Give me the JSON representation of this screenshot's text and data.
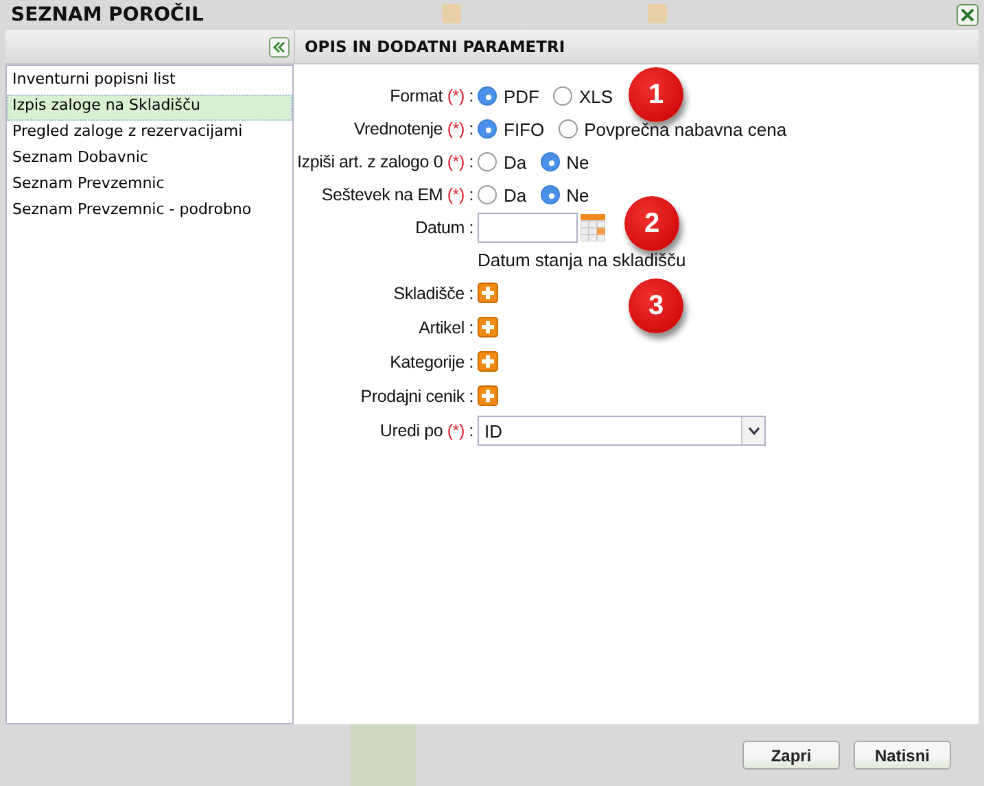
{
  "dialog": {
    "title": "SEZNAM POROČIL"
  },
  "report_list": {
    "items": [
      {
        "label": "Inventurni popisni list",
        "selected": false
      },
      {
        "label": "Izpis zaloge na Skladišču",
        "selected": true
      },
      {
        "label": "Pregled zaloge z rezervacijami",
        "selected": false
      },
      {
        "label": "Seznam Dobavnic",
        "selected": false
      },
      {
        "label": "Seznam Prevzemnic",
        "selected": false
      },
      {
        "label": "Seznam Prevzemnic - podrobno",
        "selected": false
      }
    ]
  },
  "params": {
    "title": "OPIS IN DODATNI PARAMETRI",
    "fields": [
      {
        "kind": "radio",
        "label": "Format",
        "required_mark": "(*)",
        "separator": ":",
        "options": [
          {
            "label": "PDF",
            "selected": true
          },
          {
            "label": "XLS",
            "selected": false
          }
        ]
      },
      {
        "kind": "radio",
        "label": "Vrednotenje",
        "required_mark": "(*)",
        "separator": ":",
        "options": [
          {
            "label": "FIFO",
            "selected": true
          },
          {
            "label": "Povprečna nabavna cena",
            "selected": false
          }
        ]
      },
      {
        "kind": "radio",
        "label": "Izpiši art. z zalogo 0",
        "required_mark": "(*)",
        "separator": ":",
        "options": [
          {
            "label": "Da",
            "selected": false
          },
          {
            "label": "Ne",
            "selected": true
          }
        ]
      },
      {
        "kind": "radio",
        "label": "Seštevek na EM",
        "required_mark": "(*)",
        "separator": ":",
        "options": [
          {
            "label": "Da",
            "selected": false
          },
          {
            "label": "Ne",
            "selected": true
          }
        ]
      },
      {
        "kind": "date",
        "label": "Datum",
        "separator": ":",
        "hint": "Datum stanja na skladišču"
      },
      {
        "kind": "add",
        "label": "Skladišče",
        "separator": ":"
      },
      {
        "kind": "add",
        "label": "Artikel",
        "separator": ":"
      },
      {
        "kind": "add",
        "label": "Kategorije",
        "separator": ":"
      },
      {
        "kind": "add",
        "label": "Prodajni cenik",
        "separator": ":"
      },
      {
        "kind": "select",
        "label": "Uredi po",
        "required_mark": "(*)",
        "separator": ":",
        "value": "ID"
      }
    ]
  },
  "callouts": [
    "1",
    "2",
    "3"
  ],
  "buttons": [
    "Zapri",
    "Natisni"
  ]
}
